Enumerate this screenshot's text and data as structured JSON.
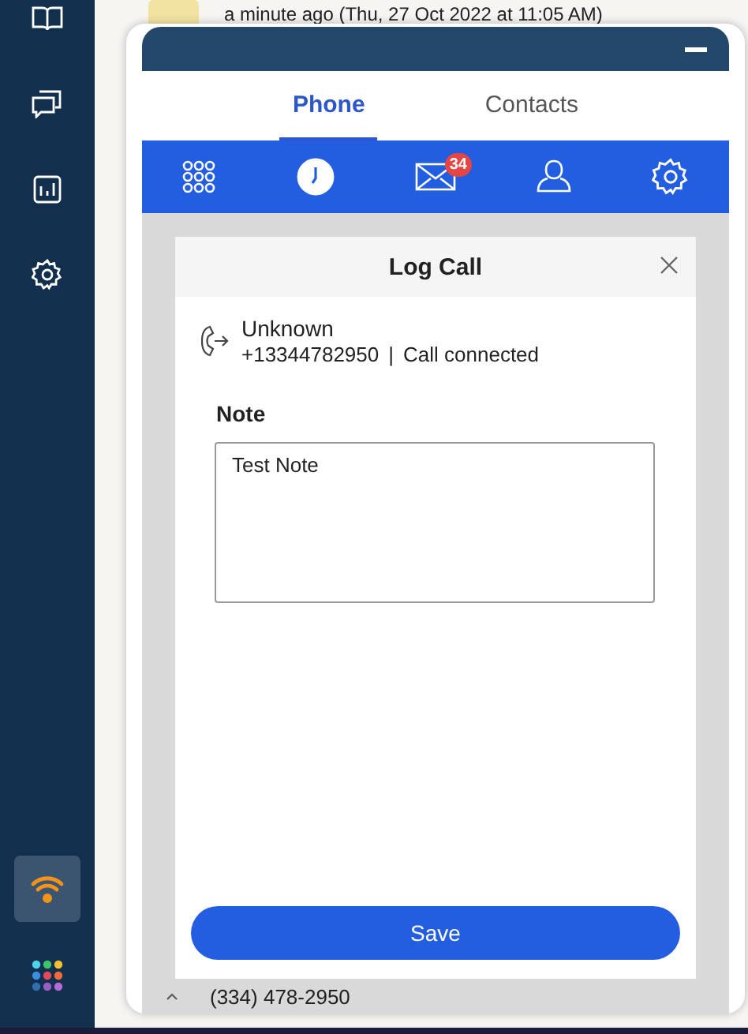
{
  "sidebar": {
    "items": [
      {
        "kind": "book",
        "selected": false
      },
      {
        "kind": "chat",
        "selected": false
      },
      {
        "kind": "chart",
        "selected": false
      },
      {
        "kind": "settings",
        "selected": false
      }
    ]
  },
  "background": {
    "activity_time": "a minute ago (Thu, 27 Oct 2022 at 11:05 AM)",
    "last_row_phone": "(334) 478-2950"
  },
  "widget": {
    "tabs": [
      {
        "label": "Phone",
        "selected": true
      },
      {
        "label": "Contacts",
        "selected": false
      }
    ],
    "toolbar": [
      {
        "kind": "dialpad",
        "selected": false
      },
      {
        "kind": "history",
        "selected": true
      },
      {
        "kind": "messages",
        "selected": false,
        "badge": "34"
      },
      {
        "kind": "contacts",
        "selected": false
      },
      {
        "kind": "settings",
        "selected": false
      }
    ],
    "dialog": {
      "title": "Log Call",
      "caller_name": "Unknown",
      "caller_number": "+13344782950",
      "separator": "|",
      "call_status": "Call connected",
      "note_label": "Note",
      "note_value": "Test Note",
      "save_label": "Save"
    }
  }
}
